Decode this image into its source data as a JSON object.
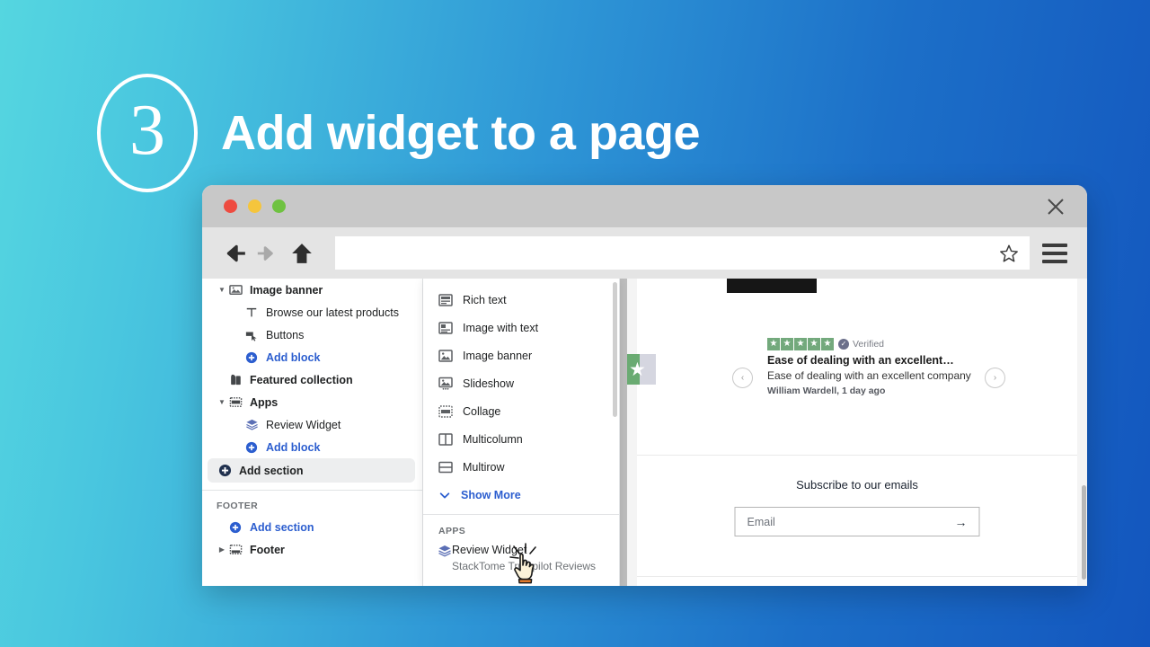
{
  "headline": {
    "step_number": "3",
    "title": "Add widget to a page"
  },
  "browser": {
    "close_label": "✕",
    "nav": {
      "back": "back-arrow",
      "forward": "forward-arrow",
      "home": "home",
      "bookmark": "star",
      "menu": "hamburger"
    },
    "url_value": ""
  },
  "sidebar": {
    "items": [
      {
        "label": "Image banner",
        "icon": "image-banner-icon",
        "type": "section",
        "expanded": true
      },
      {
        "label": "Browse our latest products",
        "icon": "text-icon",
        "type": "block"
      },
      {
        "label": "Buttons",
        "icon": "buttons-icon",
        "type": "block"
      },
      {
        "label": "Add block",
        "icon": "plus-circle-icon",
        "type": "link"
      },
      {
        "label": "Featured collection",
        "icon": "tag-icon",
        "type": "section"
      },
      {
        "label": "Apps",
        "icon": "apps-icon",
        "type": "section",
        "expanded": true
      },
      {
        "label": "Review Widget",
        "icon": "layers-icon",
        "type": "block"
      },
      {
        "label": "Add block",
        "icon": "plus-circle-icon",
        "type": "link"
      },
      {
        "label": "Add section",
        "icon": "plus-circle-icon",
        "type": "active"
      }
    ],
    "footer_caption": "FOOTER",
    "footer_add_section": "Add section",
    "footer_label": "Footer"
  },
  "dropdown": {
    "sections": [
      {
        "label": "Rich text",
        "icon": "rich-text-icon"
      },
      {
        "label": "Image with text",
        "icon": "image-with-text-icon"
      },
      {
        "label": "Image banner",
        "icon": "image-banner-icon"
      },
      {
        "label": "Slideshow",
        "icon": "slideshow-icon"
      },
      {
        "label": "Collage",
        "icon": "collage-icon"
      },
      {
        "label": "Multicolumn",
        "icon": "multicolumn-icon"
      },
      {
        "label": "Multirow",
        "icon": "multirow-icon"
      }
    ],
    "show_more": "Show More",
    "apps_caption": "APPS",
    "app": {
      "name": "Review Widget",
      "subtitle": "StackTome Trustpilot Reviews"
    }
  },
  "preview": {
    "review": {
      "rating": 5,
      "verified_label": "Verified",
      "title": "Ease of dealing with an excellent…",
      "body": "Ease of dealing with an excellent company",
      "meta": "William Wardell, 1 day ago",
      "prev_label": "‹",
      "next_label": "›"
    },
    "subscribe": {
      "title": "Subscribe to our emails",
      "placeholder": "Email",
      "submit_label": "→"
    }
  },
  "colors": {
    "gradient_start": "#55D6E0",
    "gradient_end": "#1356BE",
    "link_blue": "#2c5ecf",
    "star_green": "#73a97c",
    "text_dark": "#202223"
  }
}
